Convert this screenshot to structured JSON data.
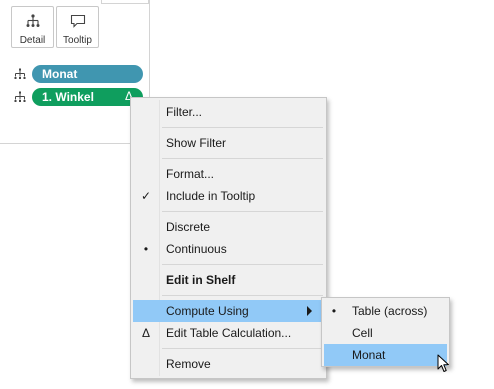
{
  "marks_card": {
    "buttons": [
      {
        "label": "Detail",
        "icon": "detail-icon"
      },
      {
        "label": "Tooltip",
        "icon": "tooltip-icon"
      }
    ],
    "pills": [
      {
        "label": "Monat",
        "icon": "hierarchy-icon",
        "color": "#4096b0"
      },
      {
        "label": "1. Winkel",
        "icon": "hierarchy-icon",
        "color": "#0f9e5e",
        "badge": "Δ"
      }
    ]
  },
  "context_menu": {
    "items": [
      {
        "label": "Filter..."
      },
      {
        "label": "Show Filter"
      },
      {
        "label": "Format..."
      },
      {
        "label": "Include in Tooltip",
        "check": "✓"
      },
      {
        "label": "Discrete"
      },
      {
        "label": "Continuous",
        "check": "•"
      },
      {
        "label": "Edit in Shelf"
      },
      {
        "label": "Compute Using",
        "submenu": true
      },
      {
        "label": "Edit Table Calculation...",
        "check": "Δ"
      },
      {
        "label": "Remove"
      }
    ],
    "highlight_color": "#91c9f7"
  },
  "submenu": {
    "items": [
      {
        "label": "Table (across)",
        "check": "•"
      },
      {
        "label": "Cell"
      },
      {
        "label": "Monat"
      }
    ]
  }
}
